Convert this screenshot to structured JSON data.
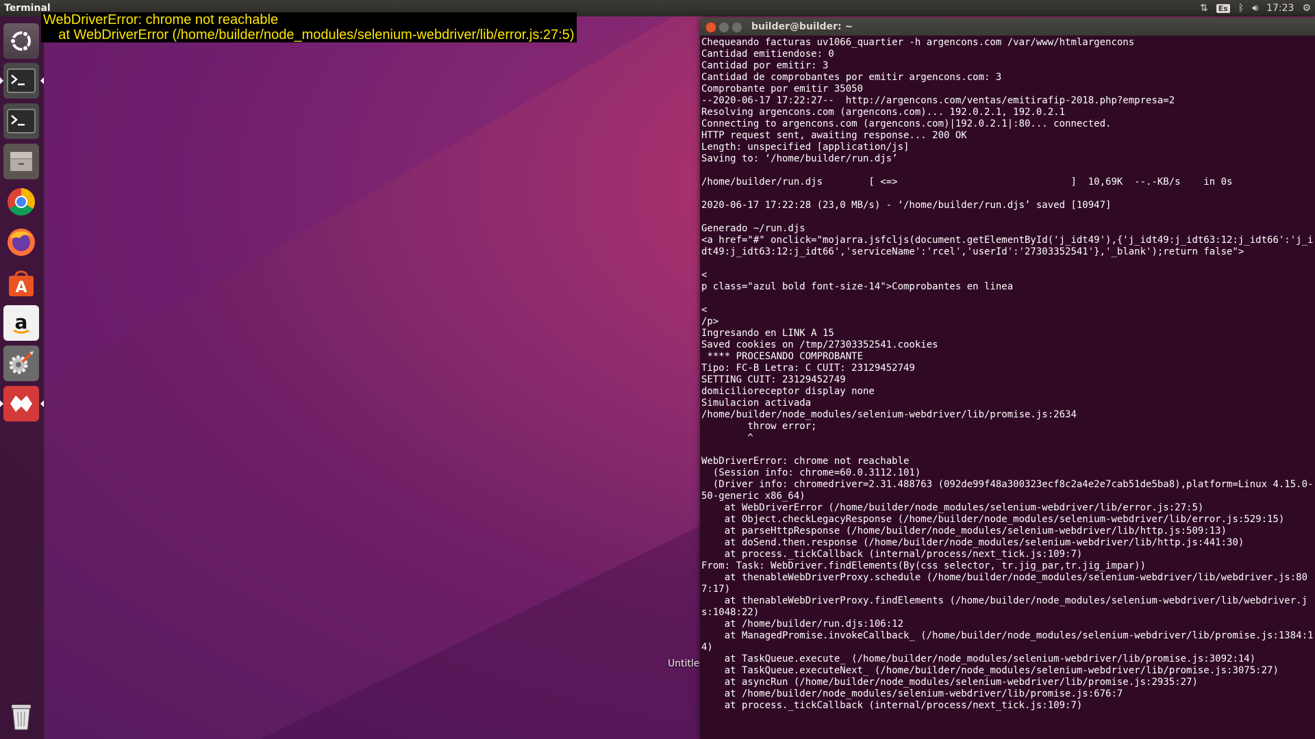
{
  "top_panel": {
    "app_title": "Terminal",
    "lang": "Es",
    "clock": "17:23"
  },
  "overlay_error": "WebDriverError: chrome not reachable\n    at WebDriverError (/home/builder/node_modules/selenium-webdriver/lib/error.js:27:5)",
  "launcher": {
    "items": [
      {
        "name": "ubuntu-dash-icon"
      },
      {
        "name": "terminal-icon"
      },
      {
        "name": "terminal-icon"
      },
      {
        "name": "files-icon"
      },
      {
        "name": "chrome-icon"
      },
      {
        "name": "firefox-icon"
      },
      {
        "name": "software-center-icon"
      },
      {
        "name": "amazon-icon"
      },
      {
        "name": "system-settings-icon"
      },
      {
        "name": "anydesk-icon"
      },
      {
        "name": "trash-icon"
      }
    ]
  },
  "desktop": {
    "untitled_label": "Untitle"
  },
  "terminal": {
    "title": "builder@builder: ~",
    "output": "Chequeando facturas uv1066_quartier -h argencons.com /var/www/htmlargencons\nCantidad emitiendose: 0\nCantidad por emitir: 3\nCantidad de comprobantes por emitir argencons.com: 3\nComprobante por emitir 35050\n--2020-06-17 17:22:27--  http://argencons.com/ventas/emitirafip-2018.php?empresa=2\nResolving argencons.com (argencons.com)... 192.0.2.1, 192.0.2.1\nConnecting to argencons.com (argencons.com)|192.0.2.1|:80... connected.\nHTTP request sent, awaiting response... 200 OK\nLength: unspecified [application/js]\nSaving to: ‘/home/builder/run.djs’\n\n/home/builder/run.djs        [ <=>                              ]  10,69K  --.-KB/s    in 0s\n\n2020-06-17 17:22:28 (23,0 MB/s) - ‘/home/builder/run.djs’ saved [10947]\n\nGenerado ~/run.djs\n<a href=\"#\" onclick=\"mojarra.jsfcljs(document.getElementById('j_idt49'),{'j_idt49:j_idt63:12:j_idt66':'j_idt49:j_idt63:12:j_idt66','serviceName':'rcel','userId':'27303352541'},'_blank');return false\">\n                                                                                                                   <\np class=\"azul bold font-size-14\">Comprobantes en linea\n                                                                                                                   <\n/p>\nIngresando en LINK A 15\nSaved cookies on /tmp/27303352541.cookies\n **** PROCESANDO COMPROBANTE\nTipo: FC-B Letra: C CUIT: 23129452749\nSETTING CUIT: 23129452749\ndomicilioreceptor display none\nSimulacion activada\n/home/builder/node_modules/selenium-webdriver/lib/promise.js:2634\n        throw error;\n        ^\n\nWebDriverError: chrome not reachable\n  (Session info: chrome=60.0.3112.101)\n  (Driver info: chromedriver=2.31.488763 (092de99f48a300323ecf8c2a4e2e7cab51de5ba8),platform=Linux 4.15.0-50-generic x86_64)\n    at WebDriverError (/home/builder/node_modules/selenium-webdriver/lib/error.js:27:5)\n    at Object.checkLegacyResponse (/home/builder/node_modules/selenium-webdriver/lib/error.js:529:15)\n    at parseHttpResponse (/home/builder/node_modules/selenium-webdriver/lib/http.js:509:13)\n    at doSend.then.response (/home/builder/node_modules/selenium-webdriver/lib/http.js:441:30)\n    at process._tickCallback (internal/process/next_tick.js:109:7)\nFrom: Task: WebDriver.findElements(By(css selector, tr.jig_par,tr.jig_impar))\n    at thenableWebDriverProxy.schedule (/home/builder/node_modules/selenium-webdriver/lib/webdriver.js:807:17)\n    at thenableWebDriverProxy.findElements (/home/builder/node_modules/selenium-webdriver/lib/webdriver.js:1048:22)\n    at /home/builder/run.djs:106:12\n    at ManagedPromise.invokeCallback_ (/home/builder/node_modules/selenium-webdriver/lib/promise.js:1384:14)\n    at TaskQueue.execute_ (/home/builder/node_modules/selenium-webdriver/lib/promise.js:3092:14)\n    at TaskQueue.executeNext_ (/home/builder/node_modules/selenium-webdriver/lib/promise.js:3075:27)\n    at asyncRun (/home/builder/node_modules/selenium-webdriver/lib/promise.js:2935:27)\n    at /home/builder/node_modules/selenium-webdriver/lib/promise.js:676:7\n    at process._tickCallback (internal/process/next_tick.js:109:7)"
  }
}
